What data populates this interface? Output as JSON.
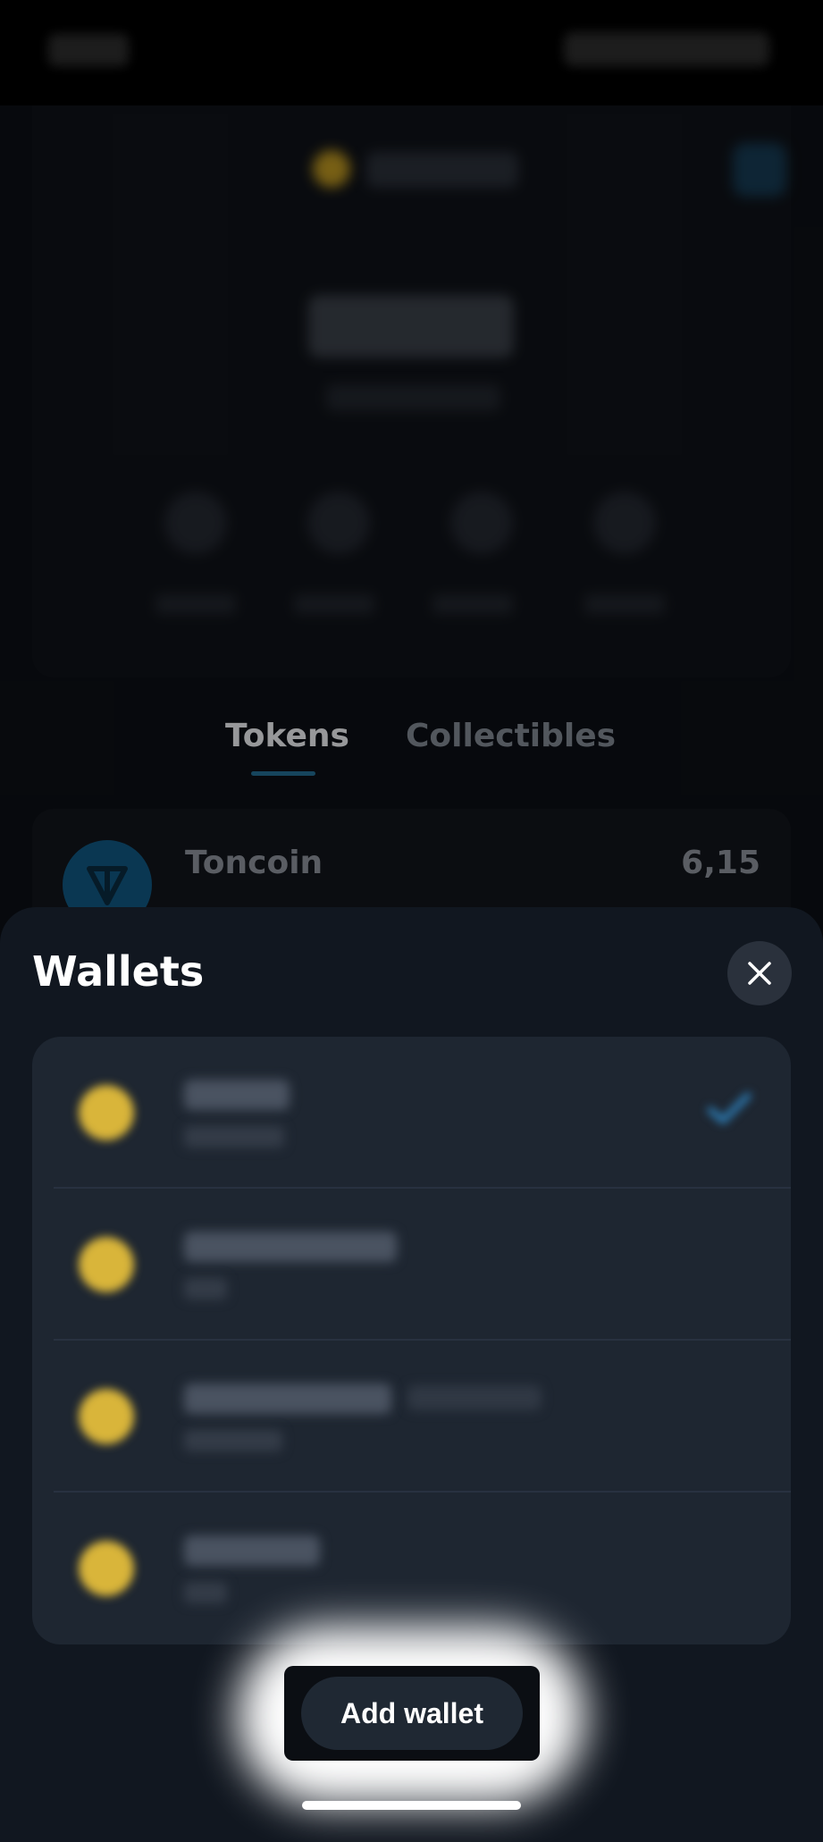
{
  "tabs": [
    {
      "label": "Tokens",
      "active": true
    },
    {
      "label": "Collectibles",
      "active": false
    }
  ],
  "token": {
    "name": "Toncoin",
    "amount": "6,15"
  },
  "sheet": {
    "title": "Wallets",
    "add_wallet_label": "Add wallet"
  },
  "colors": {
    "accent": "#226a8f",
    "sheet_bg": "#111720",
    "list_bg": "#1e2631",
    "toncoin_blue": "#10557e",
    "wallet_emoji": "#d9b53a"
  },
  "wallets": [
    {
      "icon": "emoji-icon",
      "selected": true
    },
    {
      "icon": "emoji-icon",
      "selected": false
    },
    {
      "icon": "emoji-icon",
      "selected": false
    },
    {
      "icon": "emoji-icon",
      "selected": false
    }
  ]
}
